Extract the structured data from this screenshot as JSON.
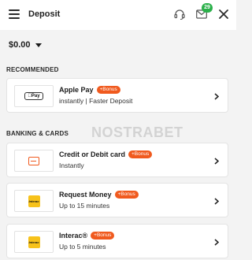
{
  "header": {
    "title": "Deposit",
    "notification_count": "29"
  },
  "balance": {
    "amount": "$0.00"
  },
  "watermark": "NOSTRABET",
  "sections": {
    "recommended": "RECOMMENDED",
    "banking": "BANKING & CARDS"
  },
  "methods": [
    {
      "title": "Apple Pay",
      "bonus": "+Bonus",
      "subtitle": "instantly | Faster Deposit",
      "logo_text": "Pay"
    },
    {
      "title": "Credit or Debit card",
      "bonus": "+Bonus",
      "subtitle": "Instantly"
    },
    {
      "title": "Request Money",
      "bonus": "+Bonus",
      "subtitle": "Up to 15 minutes",
      "logo_text": "Interac"
    },
    {
      "title": "Interac®",
      "bonus": "+Bonus",
      "subtitle": "Up to 5 minutes",
      "logo_text": "Interac"
    }
  ],
  "colors": {
    "accent": "#f05a1e",
    "badge": "#2bb04a",
    "interac_yellow": "#f7c21b"
  },
  "icons": [
    "hamburger-icon",
    "headset-icon",
    "mail-icon",
    "close-icon",
    "chevron-right-icon",
    "apple-pay-icon",
    "credit-card-icon",
    "interac-icon"
  ]
}
